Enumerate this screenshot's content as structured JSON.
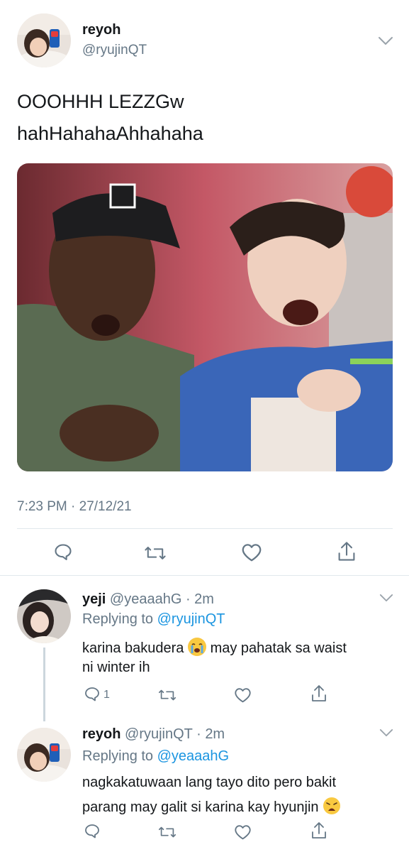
{
  "main_tweet": {
    "display_name": "reyoh",
    "handle": "@ryujinQT",
    "text_line1": "OOOHHH LEZZGw",
    "text_line2": "hahHahahaAhhahaha",
    "timestamp": "7:23 PM · 27/12/21"
  },
  "replies": [
    {
      "display_name": "yeji",
      "handle_time": "@yeaaahG · 2m",
      "replying_prefix": "Replying to",
      "replying_to": "@ryujinQT",
      "text_line1a": "karina bakudera",
      "text_line1b": "may pahatak sa waist",
      "text_line2": "ni winter ih",
      "emoji": "loudly-crying-face",
      "reply_count": "1"
    },
    {
      "display_name": "reyoh",
      "handle_time": "@ryujinQT · 2m",
      "replying_prefix": "Replying to",
      "replying_to": "@yeaaahG",
      "text_line1": "nagkakatuwaan lang tayo dito pero bakit",
      "text_line2": "parang may galit si karina kay hyunjin",
      "emoji": "weary-face"
    }
  ],
  "colors": {
    "link": "#1b95e0",
    "secondary_text": "#657786",
    "divider": "#e1e8ed",
    "icon": "#657786"
  }
}
